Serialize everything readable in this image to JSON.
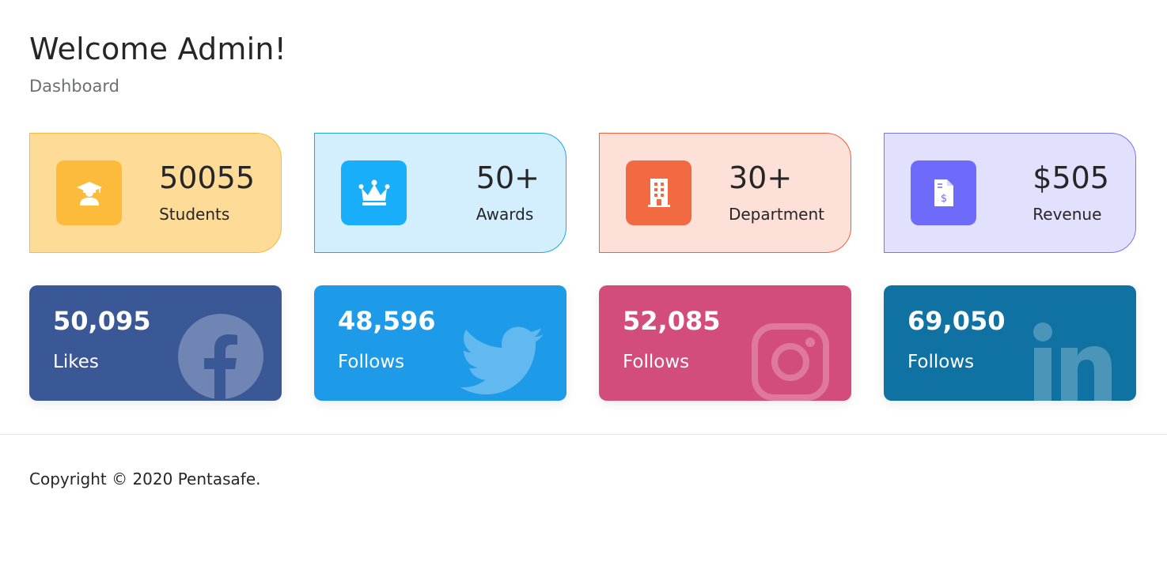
{
  "header": {
    "title": "Welcome Admin!",
    "breadcrumb": "Dashboard"
  },
  "stats": [
    {
      "value": "50055",
      "label": "Students",
      "icon": "graduate-icon",
      "color": "#fdbb3b"
    },
    {
      "value": "50+",
      "label": "Awards",
      "icon": "crown-icon",
      "color": "#18aefa"
    },
    {
      "value": "30+",
      "label": "Department",
      "icon": "building-icon",
      "color": "#f26a41"
    },
    {
      "value": "$505",
      "label": "Revenue",
      "icon": "invoice-dollar-icon",
      "color": "#6e6bfa"
    }
  ],
  "social": [
    {
      "count": "50,095",
      "label": "Likes",
      "icon": "facebook-icon",
      "color": "#3a5796"
    },
    {
      "count": "48,596",
      "label": "Follows",
      "icon": "twitter-icon",
      "color": "#1d9be8"
    },
    {
      "count": "52,085",
      "label": "Follows",
      "icon": "instagram-icon",
      "color": "#d34d7c"
    },
    {
      "count": "69,050",
      "label": "Follows",
      "icon": "linkedin-icon",
      "color": "#0f72a2"
    }
  ],
  "footer": {
    "copyright": "Copyright © 2020 Pentasafe."
  }
}
